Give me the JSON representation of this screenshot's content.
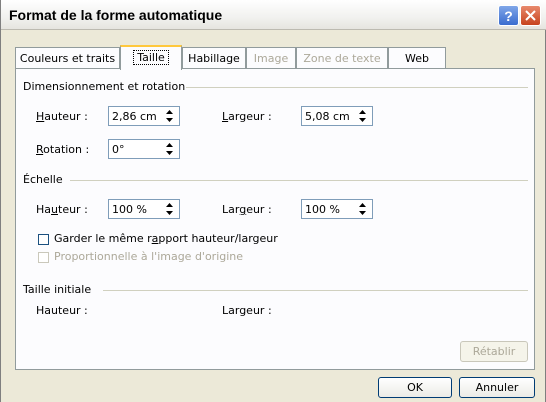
{
  "window": {
    "title": "Format de la forme automatique"
  },
  "tabs": [
    {
      "label": "Couleurs et traits",
      "state": "normal"
    },
    {
      "label": "Taille",
      "state": "active"
    },
    {
      "label": "Habillage",
      "state": "normal"
    },
    {
      "label": "Image",
      "state": "disabled"
    },
    {
      "label": "Zone de texte",
      "state": "disabled"
    },
    {
      "label": "Web",
      "state": "normal"
    }
  ],
  "sections": {
    "dimensions": {
      "title": "Dimensionnement et rotation",
      "height_label_u": "H",
      "height_label_rest": "auteur :",
      "height_value": "2,86 cm",
      "width_label_u": "L",
      "width_label_rest": "argeur :",
      "width_value": "5,08 cm",
      "rotation_label_u": "R",
      "rotation_label_rest": "otation :",
      "rotation_value": "0°"
    },
    "scale": {
      "title": "Échelle",
      "height_label_pre": "Ha",
      "height_label_u": "u",
      "height_label_rest": "teur :",
      "height_value": "100 %",
      "width_label_pre": "Lar",
      "width_label_u": "g",
      "width_label_rest": "eur :",
      "width_value": "100 %",
      "lock_ratio_pre": "Garder le même r",
      "lock_ratio_u": "a",
      "lock_ratio_rest": "pport hauteur/largeur",
      "lock_ratio_checked": false,
      "relative_label": "Proportionnelle à l'image d'origine",
      "relative_checked": false
    },
    "original": {
      "title": "Taille initiale",
      "height_label": "Hauteur :",
      "width_label": "Largeur :"
    }
  },
  "buttons": {
    "reset": "Rétablir",
    "ok": "OK",
    "cancel": "Annuler"
  }
}
